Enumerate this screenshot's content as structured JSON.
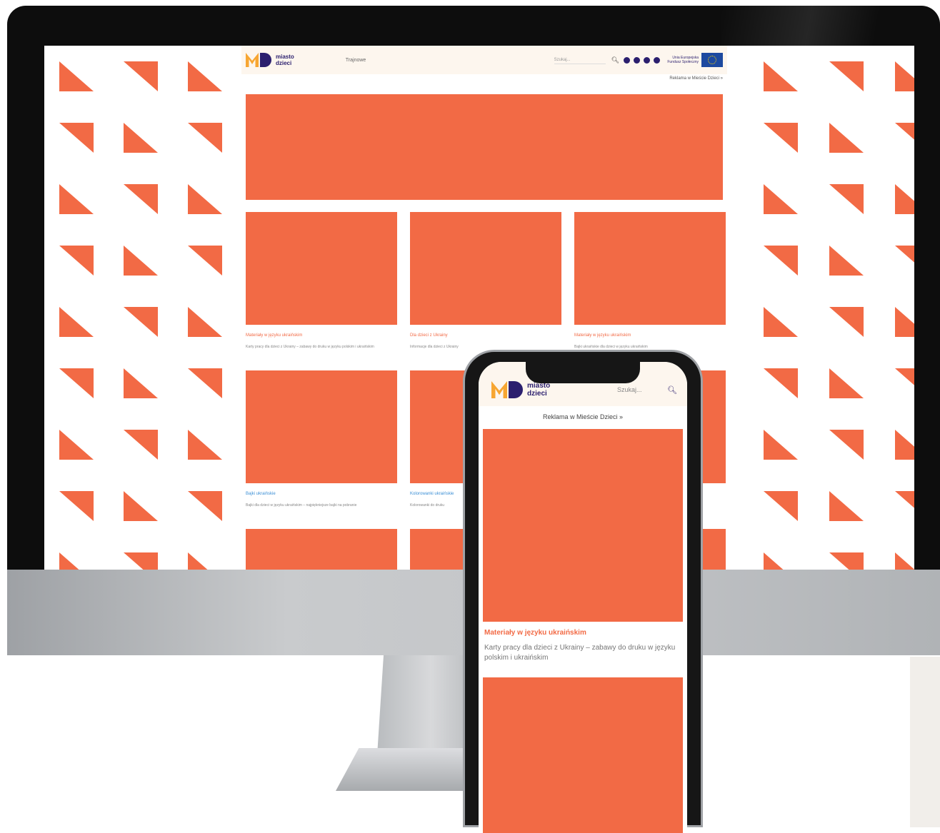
{
  "colors": {
    "accent": "#f26a45",
    "navy": "#2b1f6e",
    "link_blue": "#3b8fd6",
    "header_bg": "#fdf6ee"
  },
  "desktop": {
    "logo_text_line1": "miasto",
    "logo_text_line2": "dzieci",
    "nav_link": "Trajnowe",
    "search_placeholder": "Szukaj...",
    "eu_text": "Unia Europejska Fundusz Społeczny",
    "ad_link": "Reklama w Mieście Dzieci »",
    "cards": [
      {
        "title": "Materiały w języku ukraińskim",
        "desc": "Karty pracy dla dzieci z Ukrainy – zabawy do druku w języku polskim i ukraińskim",
        "title_color": "orange"
      },
      {
        "title": "Dla dzieci z Ukrainy",
        "desc": "Informacje dla dzieci z Ukrainy",
        "title_color": "orange"
      },
      {
        "title": "Materiały w języku ukraińskim",
        "desc": "Bajki ukraińskie dla dzieci w języku ukraińskim",
        "title_color": "orange"
      },
      {
        "title": "Bajki ukraińskie",
        "desc": "Bajki dla dzieci w języku ukraińskim – najpiękniejsze bajki na pobranie",
        "title_color": "blue"
      },
      {
        "title": "Kolorowanki ukraińskie",
        "desc": "Kolorowanki do druku",
        "title_color": "blue"
      },
      {
        "title": "",
        "desc": "",
        "title_color": "blue"
      }
    ]
  },
  "mobile": {
    "logo_text_line1": "miasto",
    "logo_text_line2": "dzieci",
    "search_placeholder": "Szukaj...",
    "ad_link": "Reklama w Mieście Dzieci »",
    "card_title": "Materiały w języku ukraińskim",
    "card_desc": "Karty pracy dla dzieci z Ukrainy – zabawy do druku w języku polskim i ukraińskim"
  },
  "icons": [
    "search-icon",
    "instagram-icon",
    "facebook-icon",
    "youtube-icon",
    "email-icon",
    "eu-flag-icon"
  ]
}
